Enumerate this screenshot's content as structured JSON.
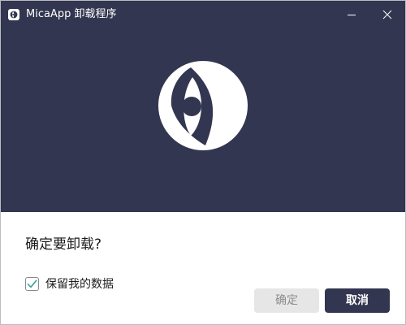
{
  "window": {
    "title": "MicaApp 卸载程序",
    "app_icon": "app-logo-icon",
    "controls": {
      "minimize_icon": "minimize-icon",
      "close_icon": "close-icon"
    }
  },
  "hero": {
    "logo_icon": "eye-logo-icon"
  },
  "dialog": {
    "question": "确定要卸载?",
    "keep_data_checkbox": {
      "label": "保留我的数据",
      "checked": true
    },
    "confirm_button": "确定",
    "cancel_button": "取消"
  },
  "colors": {
    "brand": "#323650",
    "check_accent": "#3aa39a",
    "disabled_button_bg": "#e6e6e6",
    "disabled_button_text": "#8d8d8d"
  }
}
